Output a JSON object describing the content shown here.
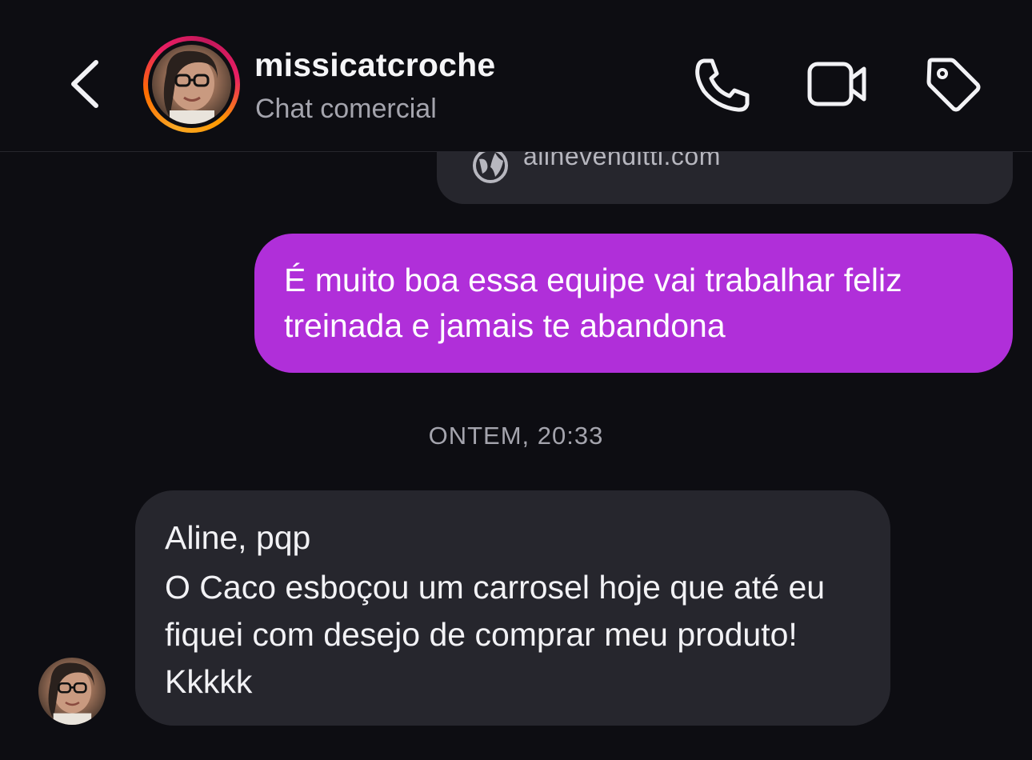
{
  "header": {
    "contact_name": "missicatcroche",
    "subtitle": "Chat comercial",
    "icons": {
      "back": "chevron-left-icon",
      "call": "phone-icon",
      "video": "video-camera-icon",
      "tag": "tag-icon"
    }
  },
  "link_preview": {
    "url": "alinevenditti.com",
    "icon": "globe-icon"
  },
  "messages": {
    "outgoing_1": "É muito boa essa equipe vai trabalhar feliz treinada e jamais te abandona",
    "timestamp": "ONTEM, 20:33",
    "incoming_1_line1": "Aline, pqp",
    "incoming_1_line2": "O Caco esboçou um carrosel hoje que até eu fiquei com desejo de comprar meu produto! Kkkkk"
  },
  "colors": {
    "background": "#0d0d12",
    "outgoing_bubble": "#b02fd9",
    "incoming_bubble": "#26262d",
    "secondary_text": "#a4a4ad"
  }
}
